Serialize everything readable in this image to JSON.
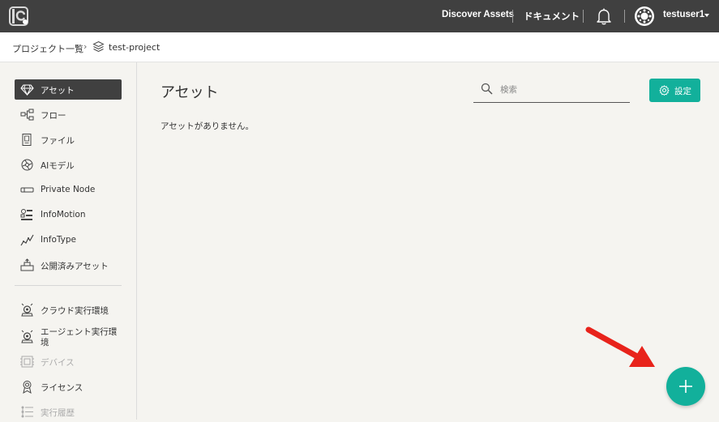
{
  "header": {
    "discover_assets": "Discover Assets",
    "documents": "ドキュメント",
    "username": "testuser1"
  },
  "breadcrumb": {
    "project_list": "プロジェクト一覧",
    "separator": "›",
    "current_project": "test-project"
  },
  "sidebar": {
    "items": [
      {
        "label": "アセット",
        "icon": "gem-icon",
        "active": true
      },
      {
        "label": "フロー",
        "icon": "flow-icon"
      },
      {
        "label": "ファイル",
        "icon": "file-icon"
      },
      {
        "label": "AIモデル",
        "icon": "ai-model-icon"
      },
      {
        "label": "Private Node",
        "icon": "private-node-icon"
      },
      {
        "label": "InfoMotion",
        "icon": "infomotion-icon"
      },
      {
        "label": "InfoType",
        "icon": "infotype-icon"
      },
      {
        "label": "公開済みアセット",
        "icon": "published-assets-icon"
      },
      {
        "label": "クラウド実行環境",
        "icon": "cloud-runtime-icon"
      },
      {
        "label": "エージェント実行環境",
        "icon": "agent-runtime-icon"
      },
      {
        "label": "デバイス",
        "icon": "device-icon",
        "disabled": true
      },
      {
        "label": "ライセンス",
        "icon": "license-icon"
      },
      {
        "label": "実行履歴",
        "icon": "history-icon",
        "disabled": true
      }
    ]
  },
  "main": {
    "title": "アセット",
    "search_placeholder": "検索",
    "settings_label": "設定",
    "empty_message": "アセットがありません。"
  },
  "colors": {
    "accent": "#12b09b",
    "topbar": "#404040",
    "annotation_arrow": "#e8231b"
  }
}
